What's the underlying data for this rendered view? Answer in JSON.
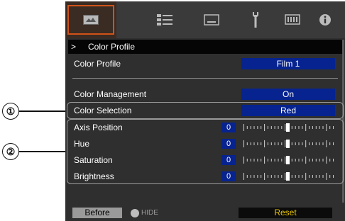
{
  "tabs": [
    {
      "name": "picture-tab-icon",
      "active": true
    },
    {
      "name": "settings-list-tab-icon",
      "active": false
    },
    {
      "name": "display-tab-icon",
      "active": false
    },
    {
      "name": "tools-tab-icon",
      "active": false
    },
    {
      "name": "installation-tab-icon",
      "active": false
    },
    {
      "name": "info-tab-icon",
      "active": false
    }
  ],
  "header": {
    "chevron": ">",
    "title": "Color Profile"
  },
  "color_profile": {
    "label": "Color Profile",
    "value": "Film 1"
  },
  "color_management": {
    "label": "Color Management",
    "value": "On"
  },
  "color_selection": {
    "label": "Color Selection",
    "value": "Red"
  },
  "adjustments": [
    {
      "label": "Axis Position",
      "value": "0"
    },
    {
      "label": "Hue",
      "value": "0"
    },
    {
      "label": "Saturation",
      "value": "0"
    },
    {
      "label": "Brightness",
      "value": "0"
    }
  ],
  "callouts": {
    "one": "①",
    "two": "②"
  },
  "footer": {
    "before": "Before",
    "hide": "HIDE",
    "reset": "Reset"
  },
  "colors": {
    "accent": "#d0531a",
    "value_bg": "#06238f",
    "reset_text": "#e8c400"
  }
}
